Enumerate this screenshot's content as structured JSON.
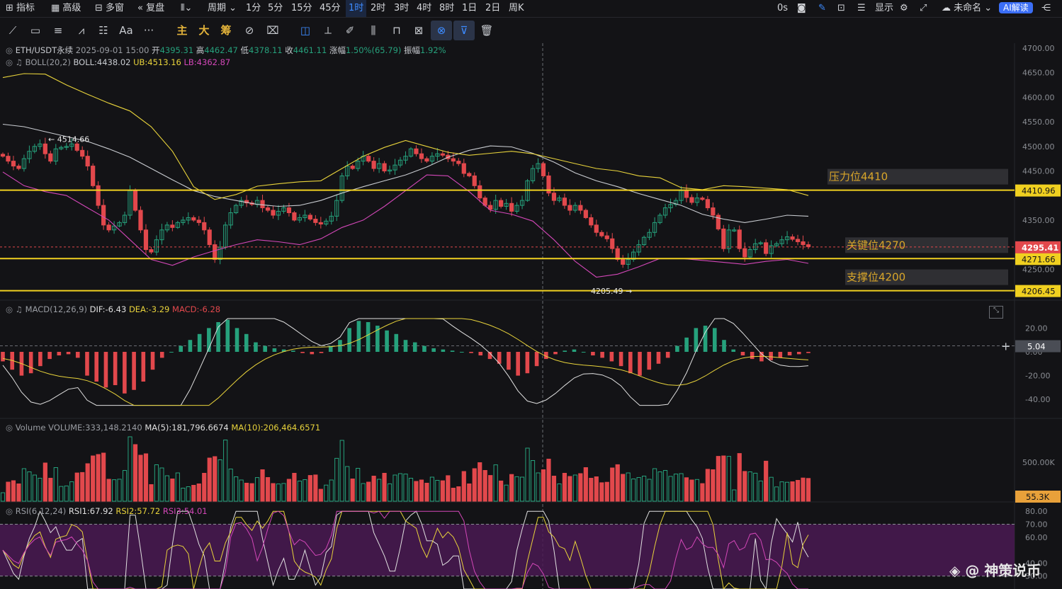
{
  "topbar": {
    "indicators_label": "指标",
    "advanced_label": "高级",
    "multiwindow_label": "多窗",
    "replay_label": "复盘",
    "period_label": "周期",
    "intervals": [
      "1分",
      "5分",
      "15分",
      "45分",
      "1时",
      "2时",
      "3时",
      "4时",
      "8时",
      "1日",
      "2日",
      "周K"
    ],
    "active_interval": "1时",
    "delay_label": "0s",
    "display_label": "显示",
    "cloud_label": "未命名",
    "ai_label": "AI解读"
  },
  "toolbar": {
    "font_tool_label": "Aa",
    "more_label": "···",
    "main_label": "主",
    "big_label": "大",
    "chip_label": "筹"
  },
  "main_pane": {
    "symbol": "ETH/USDT永续",
    "datetime": "2025-09-01 15:00",
    "open_label": "开",
    "open": "4395.31",
    "high_label": "高",
    "high": "4462.47",
    "low_label": "低",
    "low": "4378.11",
    "close_label": "收",
    "close": "4461.11",
    "change_label": "涨幅",
    "change": "1.50%(65.79)",
    "amplitude_label": "振幅",
    "amplitude": "1.92%",
    "boll_name": "BOLL(20,2)",
    "boll_mid": "BOLL:4438.02",
    "boll_ub": "UB:4513.16",
    "boll_lb": "LB:4362.87",
    "high_marker": "4514.66",
    "low_marker": "4205.49",
    "axis_ticks": [
      "4700.00",
      "4650.00",
      "4600.00",
      "4550.00",
      "4500.00",
      "4450.00",
      "4350.00",
      "4250.00"
    ],
    "annotations": [
      {
        "text": "压力位4410",
        "price_tag": "4410.96"
      },
      {
        "text": "关键位4270",
        "price_tag": "4271.66"
      },
      {
        "text": "支撑位4200",
        "price_tag": "4206.45"
      }
    ],
    "last_price": "4295.41"
  },
  "macd_pane": {
    "name": "MACD(12,26,9)",
    "dif": "DIF:-6.43",
    "dea": "DEA:-3.29",
    "macd": "MACD:-6.28",
    "axis_ticks": [
      "20.00",
      "0.00",
      "-20.00",
      "-40.00"
    ],
    "crosshair_value": "5.04"
  },
  "volume_pane": {
    "name": "Volume",
    "volume": "VOLUME:333,148.2140",
    "ma5": "MA(5):181,796.6674",
    "ma10": "MA(10):206,464.6571",
    "axis_tick": "500.00K",
    "last_tag": "55.3K"
  },
  "rsi_pane": {
    "name": "RSI(6,12,24)",
    "rsi1": "RSI1:67.92",
    "rsi2": "RSI2:57.72",
    "rsi3": "RSI3:54.01",
    "axis_ticks": [
      "80.00",
      "70.00",
      "60.00",
      "40.00",
      "30.00"
    ]
  },
  "watermark": "神策说币",
  "colors": {
    "up": "#26a17c",
    "down": "#e2484c",
    "boll_ub": "#e8d33b",
    "boll_lb": "#d347b8",
    "boll_mid": "#c9ccd1",
    "level_line": "#f0d020",
    "annotation_text": "#d9a62a",
    "accent": "#3d8bff"
  },
  "chart_data": {
    "type": "candlestick",
    "title": "",
    "x_range": [
      "",
      "2025-09-01 15:00"
    ],
    "y_range": [
      4190,
      4710
    ],
    "close_series": [
      4480,
      4470,
      4460,
      4455,
      4475,
      4490,
      4500,
      4505,
      4485,
      4470,
      4495,
      4498,
      4500,
      4505,
      4492,
      4480,
      4460,
      4420,
      4380,
      4340,
      4330,
      4338,
      4345,
      4360,
      4410,
      4370,
      4330,
      4290,
      4285,
      4310,
      4330,
      4340,
      4335,
      4345,
      4350,
      4355,
      4350,
      4345,
      4330,
      4300,
      4270,
      4295,
      4340,
      4365,
      4380,
      4390,
      4385,
      4382,
      4390,
      4375,
      4370,
      4360,
      4368,
      4375,
      4365,
      4350,
      4355,
      4360,
      4352,
      4345,
      4342,
      4348,
      4358,
      4390,
      4440,
      4460,
      4455,
      4470,
      4480,
      4470,
      4455,
      4465,
      4450,
      4452,
      4462,
      4472,
      4480,
      4495,
      4485,
      4475,
      4470,
      4480,
      4485,
      4482,
      4475,
      4470,
      4465,
      4445,
      4440,
      4420,
      4395,
      4380,
      4372,
      4390,
      4378,
      4384,
      4368,
      4380,
      4390,
      4430,
      4455,
      4465,
      4440,
      4405,
      4390,
      4395,
      4380,
      4370,
      4380,
      4370,
      4355,
      4340,
      4325,
      4318,
      4312,
      4292,
      4270,
      4260,
      4270,
      4285,
      4300,
      4315,
      4325,
      4345,
      4360,
      4375,
      4382,
      4390,
      4410,
      4396,
      4386,
      4395,
      4392,
      4375,
      4360,
      4332,
      4292,
      4330,
      4330,
      4292,
      4275,
      4290,
      4302,
      4304,
      4282,
      4298,
      4302,
      4310,
      4316,
      4311,
      4306,
      4300,
      4296
    ],
    "series": [
      {
        "name": "BOLL",
        "values": [
          4545,
          4540,
          4530,
          4520,
          4510,
          4495,
          4478,
          4455,
          4432,
          4410,
          4398,
          4390,
          4382,
          4378,
          4380,
          4390,
          4405,
          4418,
          4430,
          4442,
          4458,
          4478,
          4492,
          4501,
          4499,
          4486,
          4468,
          4446,
          4430,
          4418,
          4404,
          4392,
          4380,
          4362,
          4352,
          4345,
          4352,
          4360,
          4358
        ]
      },
      {
        "name": "UB",
        "values": [
          4640,
          4648,
          4647,
          4625,
          4606,
          4588,
          4572,
          4540,
          4490,
          4418,
          4392,
          4402,
          4419,
          4424,
          4428,
          4430,
          4455,
          4480,
          4498,
          4512,
          4500,
          4488,
          4482,
          4486,
          4490,
          4485,
          4475,
          4465,
          4455,
          4450,
          4440,
          4436,
          4416,
          4412,
          4420,
          4418,
          4415,
          4412,
          4400
        ]
      },
      {
        "name": "LB",
        "values": [
          4448,
          4420,
          4408,
          4400,
          4375,
          4350,
          4310,
          4270,
          4258,
          4275,
          4288,
          4300,
          4310,
          4306,
          4300,
          4312,
          4335,
          4350,
          4378,
          4410,
          4442,
          4440,
          4408,
          4370,
          4362,
          4348,
          4310,
          4266,
          4234,
          4240,
          4255,
          4272,
          4272,
          4268,
          4264,
          4260,
          4266,
          4270,
          4262
        ]
      }
    ],
    "macd_hist": [
      -8,
      -15,
      -20,
      -18,
      -12,
      -6,
      -3,
      -2,
      -5,
      -20,
      -25,
      -30,
      -28,
      -35,
      -32,
      -25,
      -15,
      -5,
      0,
      5,
      10,
      15,
      20,
      25,
      27,
      20,
      15,
      8,
      5,
      3,
      2,
      1,
      -1,
      -2,
      -1,
      5,
      10,
      20,
      26,
      25,
      22,
      18,
      15,
      10,
      8,
      5,
      3,
      2,
      1,
      0,
      -1,
      -3,
      -6,
      -10,
      -15,
      -20,
      -18,
      -12,
      -6,
      -2,
      1,
      2,
      0,
      -3,
      -5,
      -8,
      -12,
      -18,
      -20,
      -15,
      -10,
      -5,
      5,
      12,
      20,
      22,
      20,
      10,
      2,
      -3,
      -6,
      -8,
      -7,
      -5,
      -3,
      -2,
      -1
    ],
    "rsi_series": [
      {
        "name": "RSI1",
        "last": 67.92
      },
      {
        "name": "RSI2",
        "last": 57.72
      },
      {
        "name": "RSI3",
        "last": 54.01
      }
    ]
  }
}
